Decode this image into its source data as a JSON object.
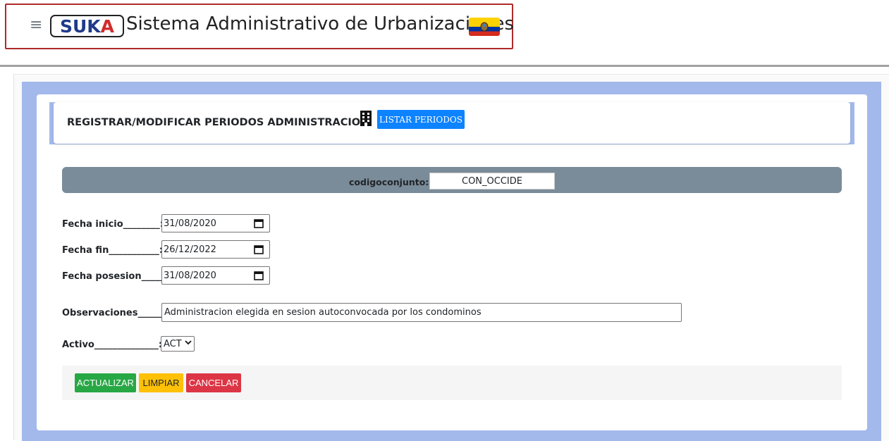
{
  "header": {
    "menu_icon": "hamburger-menu-icon",
    "logo_part1": "SUK",
    "logo_part2": "A",
    "title": "Sistema Administrativo de Urbanizaciones",
    "flag_icon": "ecuador-flag-icon",
    "colors": {
      "border": "#b02a2a",
      "logo_blue": "#1f3a8a",
      "logo_red": "#d12b2b"
    }
  },
  "page": {
    "title": "REGISTRAR/MODIFICAR PERIODOS ADMINISTRACION",
    "title_icon": "building-icon",
    "listar_button": "LISTAR PERIODOS"
  },
  "conjunto": {
    "label": "codigoconjunto:",
    "value": "CON_OCCIDE"
  },
  "form": {
    "fecha_inicio": {
      "label": "Fecha inicio________:",
      "value": "31/08/2020"
    },
    "fecha_fin": {
      "label": "Fecha fin___________:",
      "value": "26/12/2022"
    },
    "fecha_posesion": {
      "label": "Fecha posesion_____:",
      "value": "31/08/2020"
    },
    "observaciones": {
      "label": "Observaciones______:",
      "value": "Administracion elegida en sesion autoconvocada por los condominos"
    },
    "activo": {
      "label": "Activo______________:",
      "value": "ACT"
    }
  },
  "actions": {
    "actualizar": "ACTUALIZAR",
    "limpiar": "LIMPIAR",
    "cancelar": "CANCELAR"
  },
  "colors": {
    "primary": "#0d83ff",
    "success": "#28a745",
    "warning": "#ffc107",
    "danger": "#dc3545",
    "band": "#7a8b99",
    "frame": "#a3b9ec"
  }
}
